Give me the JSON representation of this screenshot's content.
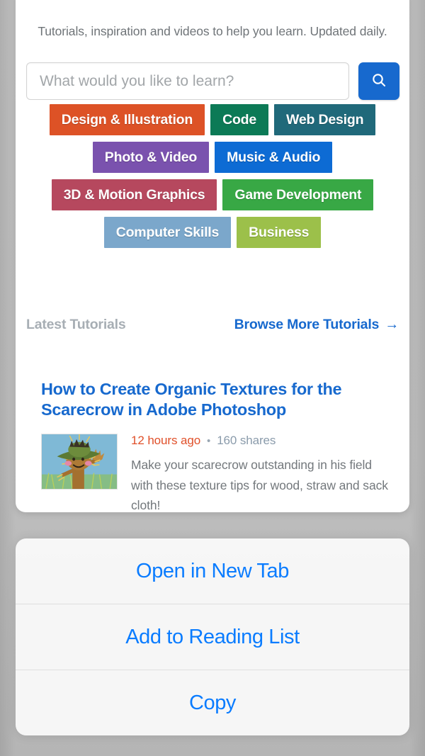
{
  "page": {
    "tagline": "Tutorials, inspiration and videos to help you learn. Updated daily."
  },
  "search": {
    "placeholder": "What would you like to learn?",
    "value": "",
    "button_icon": "search-icon",
    "button_color": "#1769ce"
  },
  "categories": [
    [
      {
        "label": "Design & Illustration",
        "color": "#dd5226"
      },
      {
        "label": "Code",
        "color": "#0c7a56"
      },
      {
        "label": "Web Design",
        "color": "#20697a"
      }
    ],
    [
      {
        "label": "Photo & Video",
        "color": "#7a52ae"
      },
      {
        "label": "Music & Audio",
        "color": "#0d6bd4"
      }
    ],
    [
      {
        "label": "3D & Motion Graphics",
        "color": "#b6485e"
      },
      {
        "label": "Game Development",
        "color": "#38a845"
      }
    ],
    [
      {
        "label": "Computer Skills",
        "color": "#7ba7cb"
      },
      {
        "label": "Business",
        "color": "#9cc04a"
      }
    ]
  ],
  "latest": {
    "heading": "Latest Tutorials",
    "browse_label": "Browse More Tutorials",
    "browse_arrow": "→"
  },
  "article": {
    "title": "How to Create Organic Textures for the Scarecrow in Adobe Photoshop",
    "time": "12 hours ago",
    "separator": "•",
    "shares": "160 shares",
    "excerpt": "Make your scarecrow outstanding in his field with these texture tips for wood, straw and sack cloth!",
    "thumbnail_alt": "scarecrow-illustration"
  },
  "action_sheet": {
    "items": [
      {
        "label": "Open in New Tab"
      },
      {
        "label": "Add to Reading List"
      },
      {
        "label": "Copy"
      }
    ],
    "text_color": "#0a7cff"
  }
}
